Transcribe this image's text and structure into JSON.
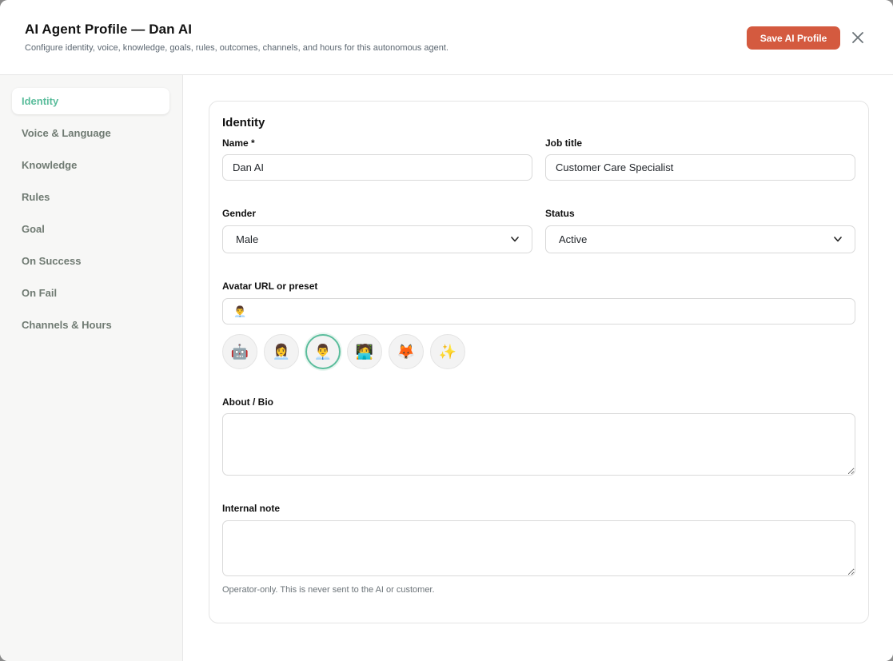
{
  "header": {
    "title": "AI Agent Profile — Dan AI",
    "subtitle": "Configure identity, voice, knowledge, goals, rules, outcomes, channels, and hours for this autonomous agent.",
    "save_label": "Save AI Profile",
    "close_icon": "close-icon"
  },
  "sidebar": {
    "items": [
      {
        "label": "Identity",
        "active": true
      },
      {
        "label": "Voice & Language"
      },
      {
        "label": "Knowledge"
      },
      {
        "label": "Rules"
      },
      {
        "label": "Goal"
      },
      {
        "label": "On Success"
      },
      {
        "label": "On Fail"
      },
      {
        "label": "Channels & Hours"
      }
    ]
  },
  "identity": {
    "section_title": "Identity",
    "name_label": "Name *",
    "name_value": "Dan AI",
    "job_title_label": "Job title",
    "job_title_value": "Customer Care Specialist",
    "gender_label": "Gender",
    "gender_value": "Male",
    "status_label": "Status",
    "status_value": "Active",
    "avatar_label": "Avatar URL or preset",
    "avatar_value": "👨‍💼",
    "avatar_presets": [
      "🤖",
      "👩‍💼",
      "👨‍💼",
      "🧑‍💻",
      "🦊",
      "✨"
    ],
    "about_label": "About / Bio",
    "about_value": "",
    "note_label": "Internal note",
    "note_value": "",
    "note_helper": "Operator-only. This is never sent to the AI or customer."
  },
  "colors": {
    "accent": "#5bbd9c",
    "primary_button": "#d45a3f"
  }
}
